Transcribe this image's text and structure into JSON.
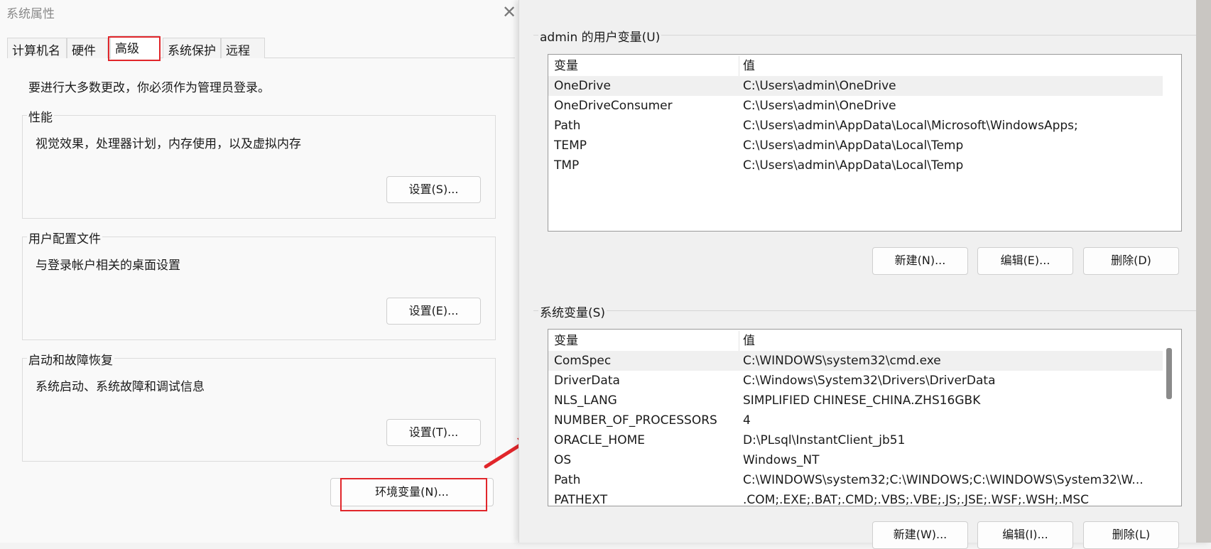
{
  "system_properties": {
    "title": "系统属性",
    "close_icon": "close-icon",
    "tabs": [
      {
        "label": "计算机名"
      },
      {
        "label": "硬件"
      },
      {
        "label": "高级"
      },
      {
        "label": "系统保护"
      },
      {
        "label": "远程"
      }
    ],
    "admin_notice": "要进行大多数更改，你必须作为管理员登录。",
    "performance": {
      "title": "性能",
      "description": "视觉效果，处理器计划，内存使用，以及虚拟内存",
      "button": "设置(S)..."
    },
    "user_profiles": {
      "title": "用户配置文件",
      "description": "与登录帐户相关的桌面设置",
      "button": "设置(E)..."
    },
    "startup_recovery": {
      "title": "启动和故障恢复",
      "description": "系统启动、系统故障和调试信息",
      "button": "设置(T)..."
    },
    "env_button": "环境变量(N)...",
    "highlight_color": "#e1262b"
  },
  "environment_variables": {
    "user_section": {
      "title": "admin 的用户变量(U)",
      "headers": {
        "name": "变量",
        "value": "值"
      },
      "rows": [
        {
          "name": "OneDrive",
          "value": "C:\\Users\\admin\\OneDrive"
        },
        {
          "name": "OneDriveConsumer",
          "value": "C:\\Users\\admin\\OneDrive"
        },
        {
          "name": "Path",
          "value": "C:\\Users\\admin\\AppData\\Local\\Microsoft\\WindowsApps;"
        },
        {
          "name": "TEMP",
          "value": "C:\\Users\\admin\\AppData\\Local\\Temp"
        },
        {
          "name": "TMP",
          "value": "C:\\Users\\admin\\AppData\\Local\\Temp"
        }
      ],
      "buttons": {
        "new": "新建(N)...",
        "edit": "编辑(E)...",
        "delete": "删除(D)"
      }
    },
    "system_section": {
      "title": "系统变量(S)",
      "headers": {
        "name": "变量",
        "value": "值"
      },
      "rows": [
        {
          "name": "ComSpec",
          "value": "C:\\WINDOWS\\system32\\cmd.exe"
        },
        {
          "name": "DriverData",
          "value": "C:\\Windows\\System32\\Drivers\\DriverData"
        },
        {
          "name": "NLS_LANG",
          "value": "SIMPLIFIED CHINESE_CHINA.ZHS16GBK"
        },
        {
          "name": "NUMBER_OF_PROCESSORS",
          "value": "4"
        },
        {
          "name": "ORACLE_HOME",
          "value": "D:\\PLsql\\InstantClient_jb51"
        },
        {
          "name": "OS",
          "value": "Windows_NT"
        },
        {
          "name": "Path",
          "value": "C:\\WINDOWS\\system32;C:\\WINDOWS;C:\\WINDOWS\\System32\\W..."
        },
        {
          "name": "PATHEXT",
          "value": ".COM;.EXE;.BAT;.CMD;.VBS;.VBE;.JS;.JSE;.WSF;.WSH;.MSC"
        }
      ],
      "buttons": {
        "new": "新建(W)...",
        "edit": "编辑(I)...",
        "delete": "删除(L)"
      }
    }
  }
}
